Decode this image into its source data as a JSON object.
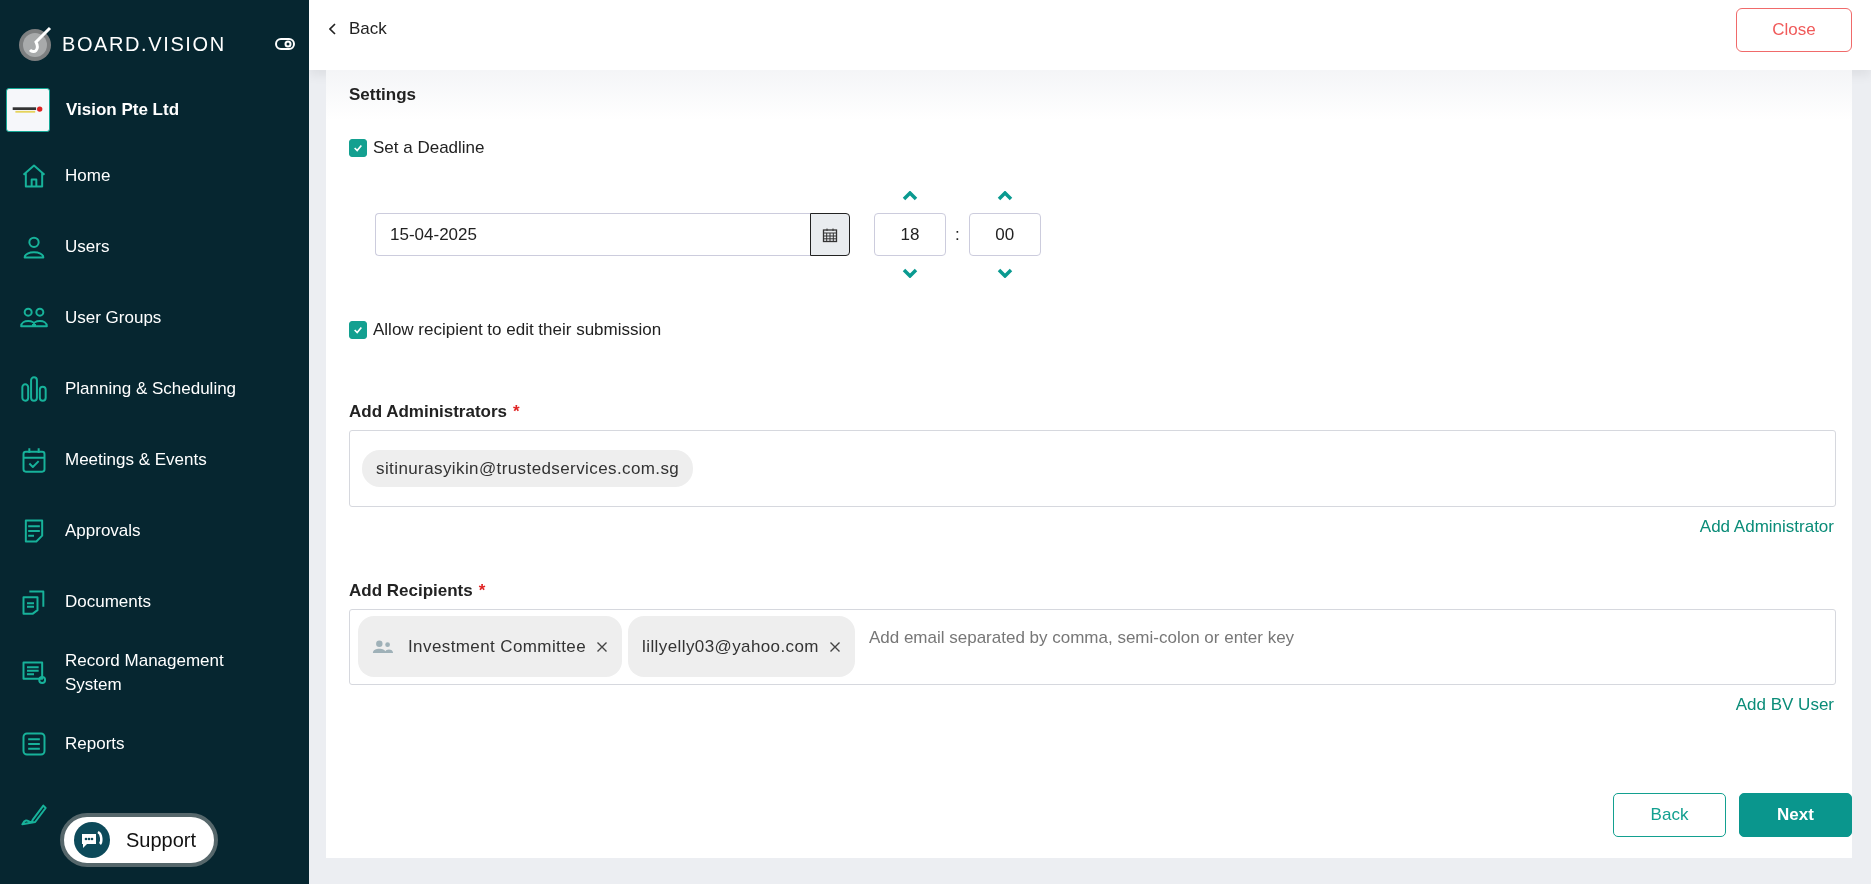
{
  "brand": {
    "name": "BOARD.VISION"
  },
  "organization": {
    "name": "Vision Pte Ltd"
  },
  "sidebar": {
    "items": [
      {
        "label": "Home"
      },
      {
        "label": "Users"
      },
      {
        "label": "User Groups"
      },
      {
        "label": "Planning & Scheduling"
      },
      {
        "label": "Meetings & Events"
      },
      {
        "label": "Approvals"
      },
      {
        "label": "Documents"
      },
      {
        "label": "Record Management System"
      },
      {
        "label": "Reports"
      }
    ]
  },
  "support_button": {
    "label": "Support"
  },
  "header": {
    "back": "Back",
    "close": "Close"
  },
  "settings": {
    "title": "Settings",
    "deadline": {
      "label": "Set a Deadline",
      "checked": true,
      "date": "15-04-2025",
      "hour": "18",
      "separator": ":",
      "minute": "00"
    },
    "allow_edit": {
      "label": "Allow recipient to edit their submission",
      "checked": true
    }
  },
  "administrators": {
    "label": "Add Administrators",
    "required_mark": "*",
    "chips": [
      {
        "label": "sitinurasyikin@trustedservices.com.sg"
      }
    ],
    "link": "Add Administrator"
  },
  "recipients": {
    "label": "Add Recipients",
    "required_mark": "*",
    "chips": [
      {
        "label": "Investment Committee",
        "kind": "group",
        "removable": true
      },
      {
        "label": "lillyelly03@yahoo.com",
        "kind": "email",
        "removable": true
      }
    ],
    "placeholder": "Add email separated by comma, semi-colon or enter key",
    "link": "Add BV User"
  },
  "footer": {
    "buttons": [
      {
        "label": "Back",
        "kind": "secondary"
      },
      {
        "label": "Next",
        "kind": "primary"
      }
    ]
  }
}
